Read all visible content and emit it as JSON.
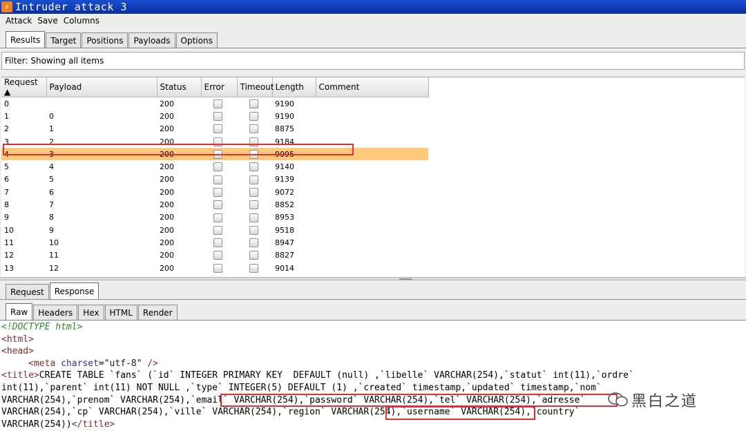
{
  "window": {
    "title": "Intruder attack 3"
  },
  "menu": [
    "Attack",
    "Save",
    "Columns"
  ],
  "main_tabs": [
    {
      "label": "Results",
      "active": true
    },
    {
      "label": "Target",
      "active": false
    },
    {
      "label": "Positions",
      "active": false
    },
    {
      "label": "Payloads",
      "active": false
    },
    {
      "label": "Options",
      "active": false
    }
  ],
  "filter": {
    "text": "Filter: Showing all items"
  },
  "table": {
    "columns": [
      "Request ▲",
      "Payload",
      "Status",
      "Error",
      "Timeout",
      "Length",
      "Comment"
    ],
    "selected_request": "4",
    "rows": [
      {
        "request": "0",
        "payload": "",
        "status": "200",
        "length": "9190"
      },
      {
        "request": "1",
        "payload": "0",
        "status": "200",
        "length": "9190"
      },
      {
        "request": "2",
        "payload": "1",
        "status": "200",
        "length": "8875"
      },
      {
        "request": "3",
        "payload": "2",
        "status": "200",
        "length": "9184"
      },
      {
        "request": "4",
        "payload": "3",
        "status": "200",
        "length": "9095"
      },
      {
        "request": "5",
        "payload": "4",
        "status": "200",
        "length": "9140"
      },
      {
        "request": "6",
        "payload": "5",
        "status": "200",
        "length": "9139"
      },
      {
        "request": "7",
        "payload": "6",
        "status": "200",
        "length": "9072"
      },
      {
        "request": "8",
        "payload": "7",
        "status": "200",
        "length": "8852"
      },
      {
        "request": "9",
        "payload": "8",
        "status": "200",
        "length": "8953"
      },
      {
        "request": "10",
        "payload": "9",
        "status": "200",
        "length": "9518"
      },
      {
        "request": "11",
        "payload": "10",
        "status": "200",
        "length": "8947"
      },
      {
        "request": "12",
        "payload": "11",
        "status": "200",
        "length": "8827"
      },
      {
        "request": "13",
        "payload": "12",
        "status": "200",
        "length": "9014"
      }
    ]
  },
  "rr_tabs": [
    {
      "label": "Request",
      "active": false
    },
    {
      "label": "Response",
      "active": true
    }
  ],
  "view_tabs": [
    {
      "label": "Raw",
      "active": true
    },
    {
      "label": "Headers",
      "active": false
    },
    {
      "label": "Hex",
      "active": false
    },
    {
      "label": "HTML",
      "active": false
    },
    {
      "label": "Render",
      "active": false
    }
  ],
  "response": {
    "doctype": "<!DOCTYPE html>",
    "html_open": "<html>",
    "head_open": "<head>",
    "meta_open": "<meta ",
    "meta_attr": "charset",
    "meta_eq": "=",
    "meta_val": "\"utf-8\"",
    "meta_close": " />",
    "title_open": "<title>",
    "line1": "CREATE TABLE `fans` (`id` INTEGER PRIMARY KEY  DEFAULT (null) ,`libelle` VARCHAR(254),`statut` int(11),`ordre`",
    "line2": "int(11),`parent` int(11) NOT NULL ,`type` INTEGER(5) DEFAULT (1) ,`created` timestamp,`updated` timestamp,`nom`",
    "line3": "VARCHAR(254),`prenom` VARCHAR(254),`email` VARCHAR(254),`password` VARCHAR(254),`tel` VARCHAR(254),`adresse`",
    "line4": "VARCHAR(254),`cp` VARCHAR(254),`ville` VARCHAR(254),`region` VARCHAR(254),`username` VARCHAR(254),`country`",
    "line5": "VARCHAR(254))",
    "title_close": "</title>"
  },
  "watermark": {
    "text": "黑白之道"
  },
  "colors": {
    "selected_row": "#ffc87a",
    "highlight_box": "#e03030",
    "titlebar": "#1a4fd0"
  }
}
